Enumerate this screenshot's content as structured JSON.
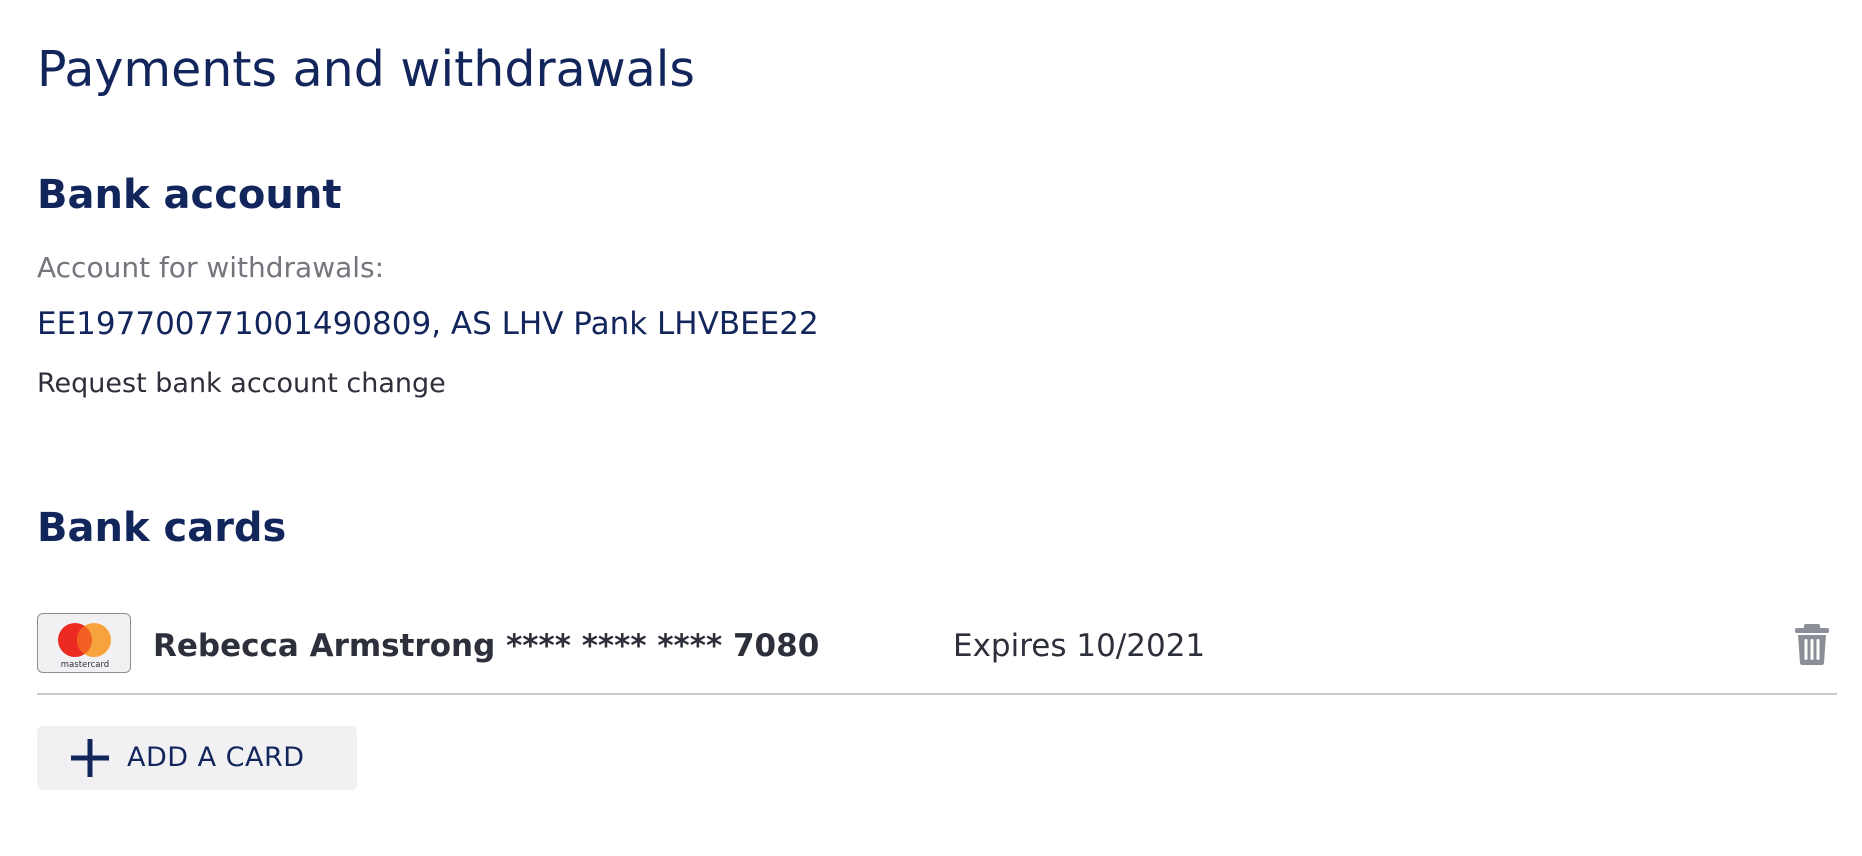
{
  "page": {
    "title": "Payments and withdrawals"
  },
  "bank_account": {
    "title": "Bank account",
    "label": "Account for withdrawals:",
    "value": "EE197700771001490809, AS LHV Pank LHVBEE22",
    "change_link": "Request bank account change"
  },
  "bank_cards": {
    "title": "Bank cards",
    "cards": [
      {
        "brand": "mastercard",
        "brand_icon": "mastercard-icon",
        "holder_and_number": "Rebecca Armstrong **** **** **** 7080",
        "expiry": "Expires 10/2021",
        "delete_icon": "trash-icon"
      }
    ],
    "add_button": {
      "icon": "plus-icon",
      "label": "ADD A CARD"
    }
  },
  "colors": {
    "heading": "#13265c",
    "muted_text": "#74767d",
    "body_text": "#2d2f3a",
    "button_bg": "#f1f1f3",
    "divider": "#c9cacf",
    "mastercard_red": "#eb2b22",
    "mastercard_orange": "#f79e33",
    "trash_gray": "#8b8e96"
  }
}
